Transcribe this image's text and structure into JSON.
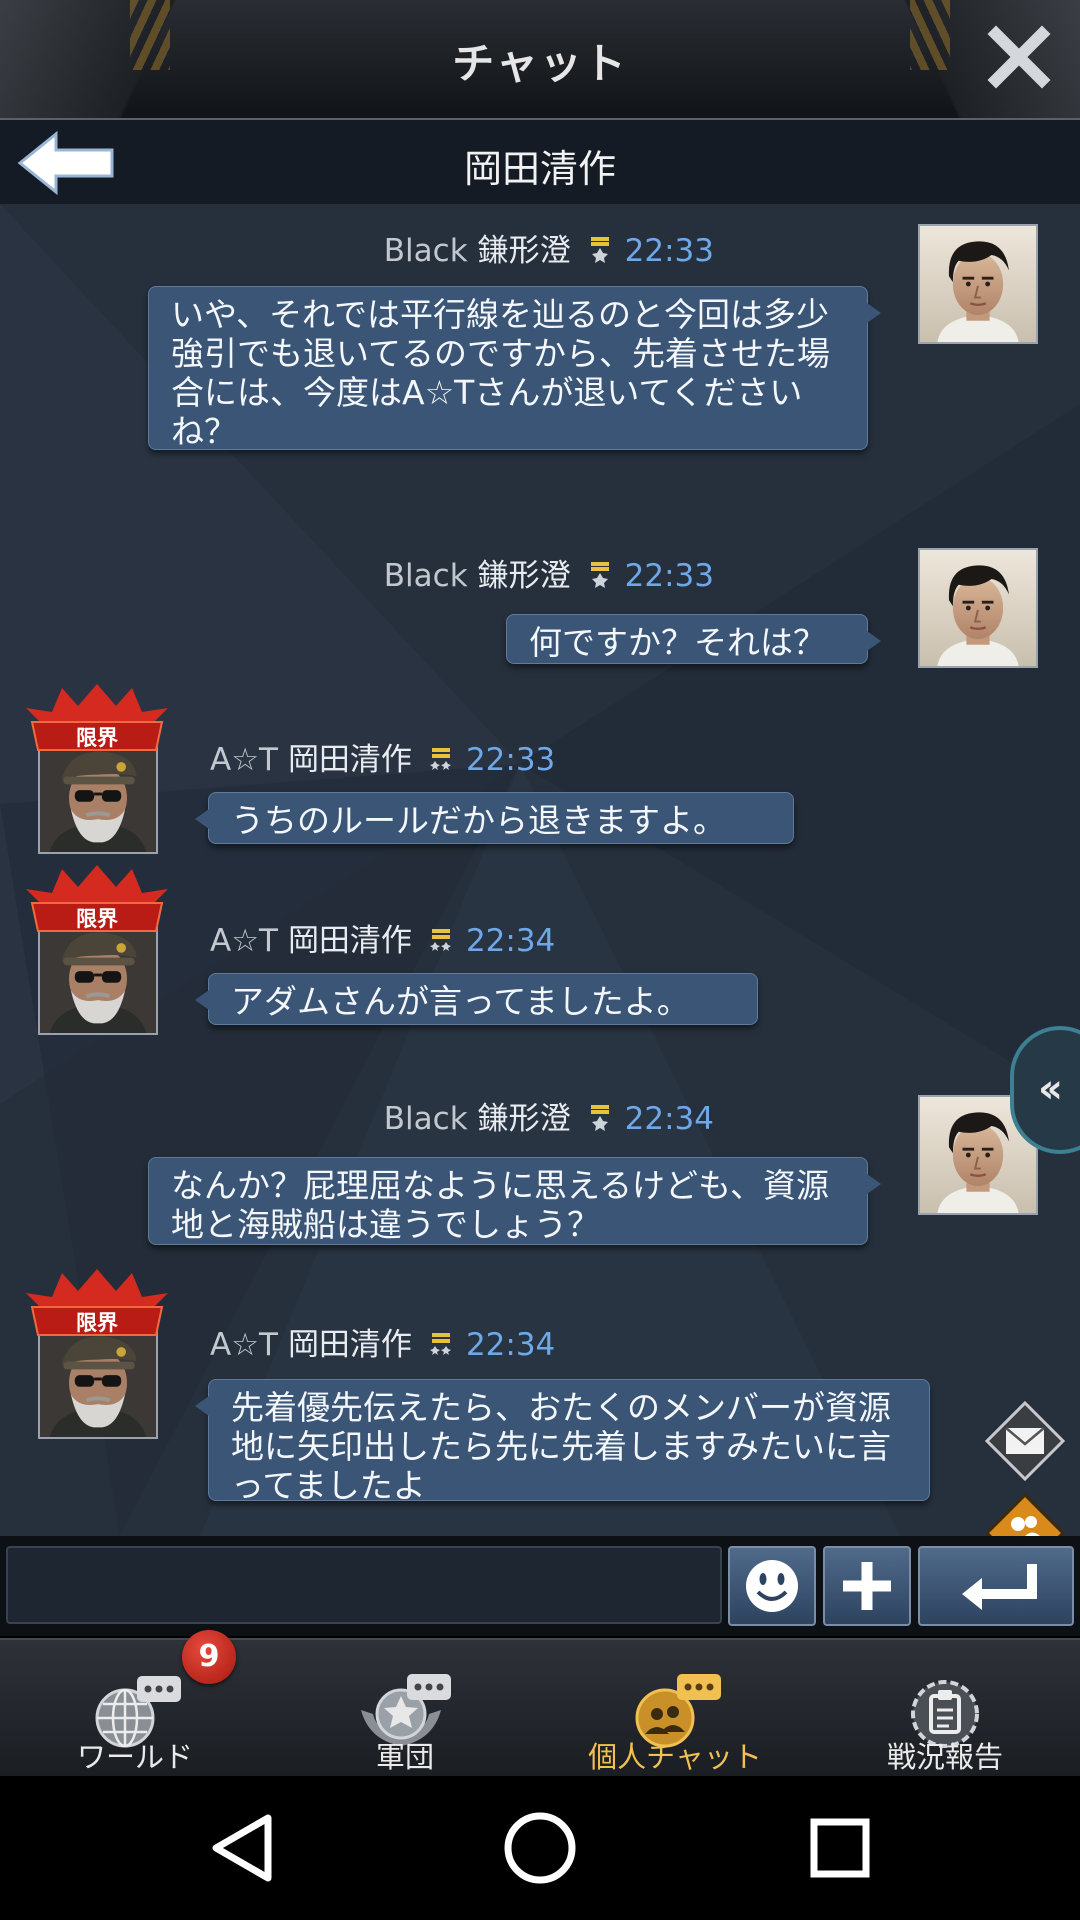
{
  "window": {
    "title": "チャット"
  },
  "conversation": {
    "name": "岡田清作"
  },
  "messages": [
    {
      "side": "right",
      "team": "Black",
      "sender": "鎌形澄",
      "time": "22:33",
      "text": "いや、それでは平行線を辿るのと今回は多少強引でも退いてるのですから、先着させた場合には、今度はA☆Tさんが退いてくださいね？"
    },
    {
      "side": "right",
      "team": "Black",
      "sender": "鎌形澄",
      "time": "22:33",
      "text": "何ですか？それは？"
    },
    {
      "side": "left",
      "team": "A☆T",
      "sender": "岡田清作",
      "time": "22:33",
      "badge": "限界",
      "text": "うちのルールだから退きますよ。"
    },
    {
      "side": "left",
      "team": "A☆T",
      "sender": "岡田清作",
      "time": "22:34",
      "badge": "限界",
      "text": "アダムさんが言ってましたよ。"
    },
    {
      "side": "right",
      "team": "Black",
      "sender": "鎌形澄",
      "time": "22:34",
      "text": "なんか？屁理屈なように思えるけども、資源地と海賊船は違うでしょう？"
    },
    {
      "side": "left",
      "team": "A☆T",
      "sender": "岡田清作",
      "time": "22:34",
      "badge": "限界",
      "text": "先着優先伝えたら、おたくのメンバーが資源地に矢印出したら先に先着しますみたいに言ってましたよ"
    }
  ],
  "input": {
    "value": "",
    "placeholder": ""
  },
  "tabs": [
    {
      "label": "ワールド",
      "icon": "globe-chat-icon",
      "badge": "9",
      "active": false
    },
    {
      "label": "軍団",
      "icon": "star-emblem-chat-icon",
      "active": false
    },
    {
      "label": "個人チャット",
      "icon": "people-chat-icon",
      "active": true
    },
    {
      "label": "戦況報告",
      "icon": "clipboard-report-icon",
      "active": false
    }
  ],
  "colors": {
    "bubble": "#3a5575",
    "time": "#6fa8e8",
    "active_tab": "#f0c050",
    "badge": "#d4322b",
    "chat_bg": "#26303d"
  },
  "system_nav": [
    "back-triangle-icon",
    "home-circle-icon",
    "recents-square-icon"
  ]
}
